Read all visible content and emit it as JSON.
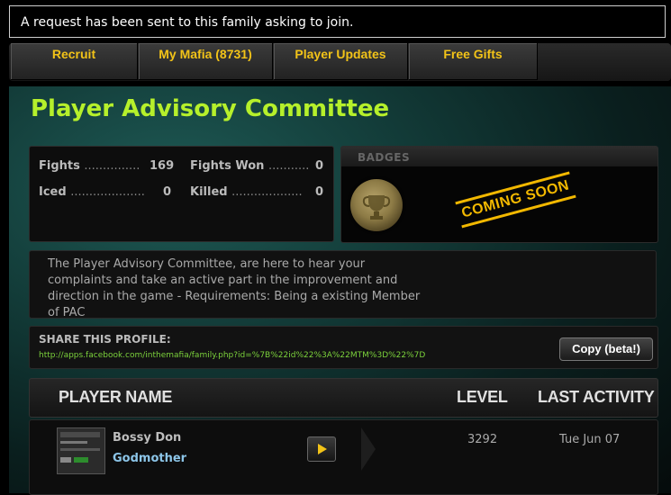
{
  "notice": {
    "text": "A request has been sent to this family asking to join."
  },
  "nav": {
    "tabs": [
      "Recruit",
      "My Mafia (8731)",
      "Player Updates",
      "Free Gifts"
    ]
  },
  "profile": {
    "title": "Player Advisory Committee",
    "stats": {
      "fights_label": "Fights",
      "fights_value": "169",
      "fights_won_label": "Fights Won",
      "fights_won_value": "0",
      "iced_label": "Iced",
      "iced_value": "0",
      "killed_label": "Killed",
      "killed_value": "0",
      "dots_long": "...............",
      "dots_won": "...........",
      "dots_iced": "....................",
      "dots_killed": "..................."
    },
    "badges": {
      "header": "BADGES",
      "coming_soon": "COMING SOON"
    },
    "description": "The Player Advisory Committee, are here to hear your complaints and take an active part in the improvement and direction in the game - Requirements: Being a existing Member of PAC"
  },
  "share": {
    "label": "SHARE THIS PROFILE:",
    "url": "http://apps.facebook.com/inthemafia/family.php?id=%7B%22id%22%3A%22MTM%3D%22%7D",
    "copy_button": "Copy (beta!)"
  },
  "table": {
    "headers": {
      "player_name": "PLAYER NAME",
      "level": "LEVEL",
      "last_activity": "LAST ACTIVITY"
    },
    "rows": [
      {
        "name": "Bossy Don",
        "rank": "Godmother",
        "level": "3292",
        "last_activity": "Tue Jun 07"
      }
    ]
  },
  "colors": {
    "title": "#b6f02b",
    "tab_text": "#f2c318",
    "stat_value": "#5b9cf0",
    "url": "#7bd13b"
  }
}
